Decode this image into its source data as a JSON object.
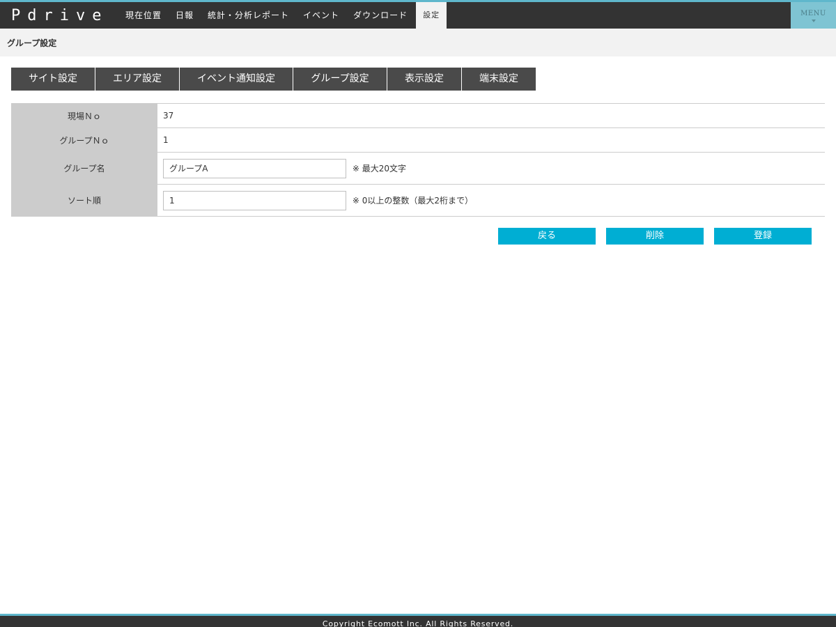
{
  "header": {
    "logo": "Pdrive",
    "nav": [
      {
        "label": "現在位置"
      },
      {
        "label": "日報"
      },
      {
        "label": "統計・分析レポート"
      },
      {
        "label": "イベント"
      },
      {
        "label": "ダウンロード"
      },
      {
        "label": "設定",
        "active": true
      }
    ],
    "menu_label": "MENU"
  },
  "page_title": "グループ設定",
  "tabs": [
    {
      "label": "サイト設定"
    },
    {
      "label": "エリア設定"
    },
    {
      "label": "イベント通知設定"
    },
    {
      "label": "グループ設定"
    },
    {
      "label": "表示設定"
    },
    {
      "label": "端末設定"
    }
  ],
  "form": {
    "site_no": {
      "label": "現場Ｎｏ",
      "value": "37"
    },
    "group_no": {
      "label": "グループＮｏ",
      "value": "1"
    },
    "group_name": {
      "label": "グループ名",
      "value": "グループA",
      "note": "※ 最大20文字"
    },
    "sort_order": {
      "label": "ソート順",
      "value": "1",
      "note": "※ 0以上の整数（最大2桁まで）"
    }
  },
  "buttons": {
    "back": "戻る",
    "delete": "削除",
    "register": "登録"
  },
  "footer": {
    "copyright": "Copyright Ecomott Inc. All Rights Reserved."
  },
  "colors": {
    "header_bg": "#333333",
    "accent": "#5fb7cc",
    "button": "#00aed3",
    "tab_bg": "#4a4a4a",
    "label_bg": "#cccccc"
  }
}
